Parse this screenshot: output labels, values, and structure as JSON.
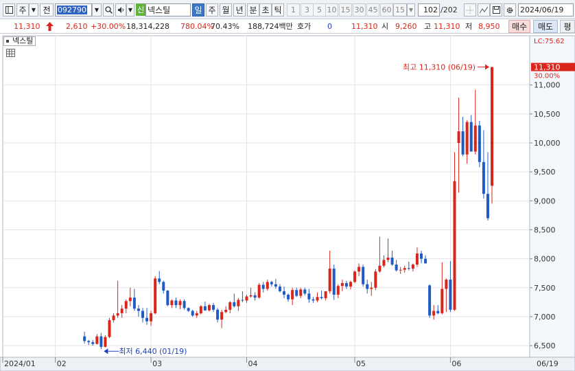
{
  "toolbar": {
    "market_label": "주",
    "prev_label": "전",
    "stock_code": "092790",
    "credit_badge": "신",
    "stock_name": "넥스틸",
    "period_tabs": [
      {
        "label": "일",
        "selected": true
      },
      {
        "label": "주",
        "selected": false
      },
      {
        "label": "월",
        "selected": false
      },
      {
        "label": "년",
        "selected": false
      },
      {
        "label": "분",
        "selected": false
      },
      {
        "label": "초",
        "selected": false
      },
      {
        "label": "틱",
        "selected": false
      }
    ],
    "interval_buttons": [
      "1",
      "3",
      "5",
      "10",
      "15",
      "30",
      "45",
      "60"
    ],
    "interval_value": "15",
    "count_value": "102",
    "count_total": "/202",
    "date_value": "2024/06/19"
  },
  "quote": {
    "price": "11,310",
    "change": "2,610",
    "change_pct": "+30.00%",
    "volume": "18,314,228",
    "volume_ratio": "780.04%",
    "turnover": "70.43%",
    "trade_value": "188,724백만",
    "hoga_label": "호가",
    "hoga_value": "0",
    "current": "11,310",
    "open_label": "시",
    "open": "9,260",
    "high_label": "고",
    "high": "11,310",
    "low_label": "저",
    "low": "8,950",
    "buy_label": "매수",
    "sell_label": "매도",
    "eval_label": "평"
  },
  "chart_header": {
    "legend_name": "넥스틸"
  },
  "chart_data": {
    "type": "candlestick",
    "symbol": "넥스틸",
    "y_ticks": [
      6500,
      7000,
      7500,
      8000,
      8500,
      9000,
      9500,
      10000,
      10500,
      11000
    ],
    "y_tick_labels": [
      "6,500",
      "7,000",
      "7,500",
      "8,000",
      "8,500",
      "9,000",
      "9,500",
      "10,000",
      "10,500",
      "11,000"
    ],
    "ylim": [
      6300,
      11850
    ],
    "x_tick_labels": [
      "2024/01",
      "02",
      "03",
      "04",
      "05",
      "06"
    ],
    "x_right_label": "06/19",
    "high_annotation": "최고 11,310 (06/19)",
    "low_annotation": "최저 6,440 (01/19)",
    "price_marker": "11,310",
    "lc_label": "LC:75.62",
    "pct_label": "30.00%",
    "colors": {
      "up": "#d9261c",
      "down": "#1e5bc6",
      "marker": "#d9261c"
    },
    "candles": [
      [
        6660,
        6740,
        6540,
        6580
      ],
      [
        6580,
        6600,
        6510,
        6560
      ],
      [
        6560,
        6600,
        6500,
        6530
      ],
      [
        6530,
        6700,
        6520,
        6660
      ],
      [
        6660,
        6720,
        6440,
        6480
      ],
      [
        6480,
        6680,
        6470,
        6650
      ],
      [
        6650,
        6980,
        6630,
        6940
      ],
      [
        6940,
        7060,
        6900,
        7020
      ],
      [
        7020,
        7620,
        6980,
        7060
      ],
      [
        7060,
        7200,
        6980,
        7140
      ],
      [
        7140,
        7300,
        7060,
        7270
      ],
      [
        7270,
        7500,
        7180,
        7330
      ],
      [
        7330,
        7480,
        7100,
        7140
      ],
      [
        7140,
        7200,
        7000,
        7100
      ],
      [
        7100,
        7150,
        6900,
        6980
      ],
      [
        6980,
        7150,
        6860,
        6920
      ],
      [
        6920,
        7100,
        6840,
        7060
      ],
      [
        7060,
        7700,
        7040,
        7660
      ],
      [
        7660,
        7790,
        7560,
        7600
      ],
      [
        7600,
        7620,
        7400,
        7450
      ],
      [
        7450,
        7460,
        7180,
        7200
      ],
      [
        7200,
        7300,
        7150,
        7280
      ],
      [
        7280,
        7330,
        7150,
        7200
      ],
      [
        7200,
        7300,
        7130,
        7270
      ],
      [
        7270,
        7300,
        7120,
        7150
      ],
      [
        7150,
        7160,
        7080,
        7100
      ],
      [
        7100,
        7120,
        7000,
        7020
      ],
      [
        7020,
        7100,
        6980,
        7060
      ],
      [
        7060,
        7200,
        7040,
        7180
      ],
      [
        7180,
        7260,
        7100,
        7110
      ],
      [
        7110,
        7220,
        7090,
        7200
      ],
      [
        7200,
        7240,
        7080,
        7120
      ],
      [
        7120,
        7150,
        6900,
        6950
      ],
      [
        6950,
        7120,
        6800,
        7080
      ],
      [
        7080,
        7180,
        7060,
        7120
      ],
      [
        7120,
        7270,
        7060,
        7250
      ],
      [
        7250,
        7400,
        7160,
        7180
      ],
      [
        7180,
        7320,
        7100,
        7290
      ],
      [
        7290,
        7440,
        7250,
        7280
      ],
      [
        7280,
        7380,
        7240,
        7350
      ],
      [
        7350,
        7500,
        7330,
        7370
      ],
      [
        7370,
        7420,
        7280,
        7330
      ],
      [
        7330,
        7580,
        7310,
        7550
      ],
      [
        7550,
        7600,
        7420,
        7480
      ],
      [
        7480,
        7640,
        7450,
        7600
      ],
      [
        7600,
        7620,
        7520,
        7560
      ],
      [
        7560,
        7650,
        7480,
        7520
      ],
      [
        7520,
        7560,
        7420,
        7440
      ],
      [
        7440,
        7520,
        7320,
        7380
      ],
      [
        7380,
        7400,
        7260,
        7300
      ],
      [
        7300,
        7500,
        7200,
        7460
      ],
      [
        7460,
        7500,
        7340,
        7360
      ],
      [
        7360,
        7500,
        7320,
        7470
      ],
      [
        7470,
        7500,
        7370,
        7400
      ],
      [
        7400,
        7480,
        7240,
        7300
      ],
      [
        7300,
        7340,
        7240,
        7280
      ],
      [
        7280,
        7420,
        7250,
        7340
      ],
      [
        7340,
        7450,
        7300,
        7320
      ],
      [
        7320,
        7440,
        7280,
        7440
      ],
      [
        7440,
        8140,
        7400,
        7830
      ],
      [
        7830,
        7900,
        7290,
        7380
      ],
      [
        7380,
        7560,
        7320,
        7530
      ],
      [
        7530,
        7640,
        7440,
        7580
      ],
      [
        7580,
        7620,
        7480,
        7520
      ],
      [
        7520,
        7620,
        7470,
        7600
      ],
      [
        7600,
        7800,
        7580,
        7780
      ],
      [
        7780,
        7920,
        7700,
        7860
      ],
      [
        7860,
        7900,
        7520,
        7560
      ],
      [
        7560,
        7640,
        7400,
        7480
      ],
      [
        7480,
        7600,
        7360,
        7500
      ],
      [
        7500,
        7820,
        7460,
        7780
      ],
      [
        7780,
        8380,
        7760,
        7880
      ],
      [
        7880,
        8060,
        7850,
        7980
      ],
      [
        7980,
        8350,
        7940,
        8020
      ],
      [
        8020,
        8140,
        7880,
        7900
      ],
      [
        7900,
        7980,
        7780,
        7800
      ],
      [
        7800,
        7860,
        7740,
        7810
      ],
      [
        7810,
        7880,
        7760,
        7840
      ],
      [
        7840,
        7950,
        7800,
        7830
      ],
      [
        7830,
        7920,
        7780,
        7900
      ],
      [
        7900,
        8200,
        7860,
        8090
      ],
      [
        8090,
        8140,
        7920,
        8000
      ],
      [
        8000,
        8060,
        7920,
        7920
      ],
      [
        7540,
        7560,
        6980,
        7020
      ],
      [
        7020,
        7200,
        6950,
        7100
      ],
      [
        7100,
        7200,
        7040,
        7060
      ],
      [
        7060,
        7940,
        7040,
        7480
      ],
      [
        7480,
        7660,
        7080,
        7640
      ],
      [
        7640,
        7960,
        7080,
        7120
      ],
      [
        7120,
        9840,
        7100,
        9340
      ],
      [
        10000,
        10780,
        9140,
        10200
      ],
      [
        10200,
        10450,
        9770,
        9800
      ],
      [
        9800,
        10390,
        9640,
        10360
      ],
      [
        10360,
        10480,
        9990,
        9850
      ],
      [
        9850,
        10920,
        9800,
        10300
      ],
      [
        10300,
        10380,
        9580,
        9670
      ],
      [
        9670,
        10220,
        9040,
        9120
      ],
      [
        9120,
        9840,
        8660,
        8700
      ],
      [
        9260,
        11310,
        8950,
        11310
      ]
    ]
  }
}
